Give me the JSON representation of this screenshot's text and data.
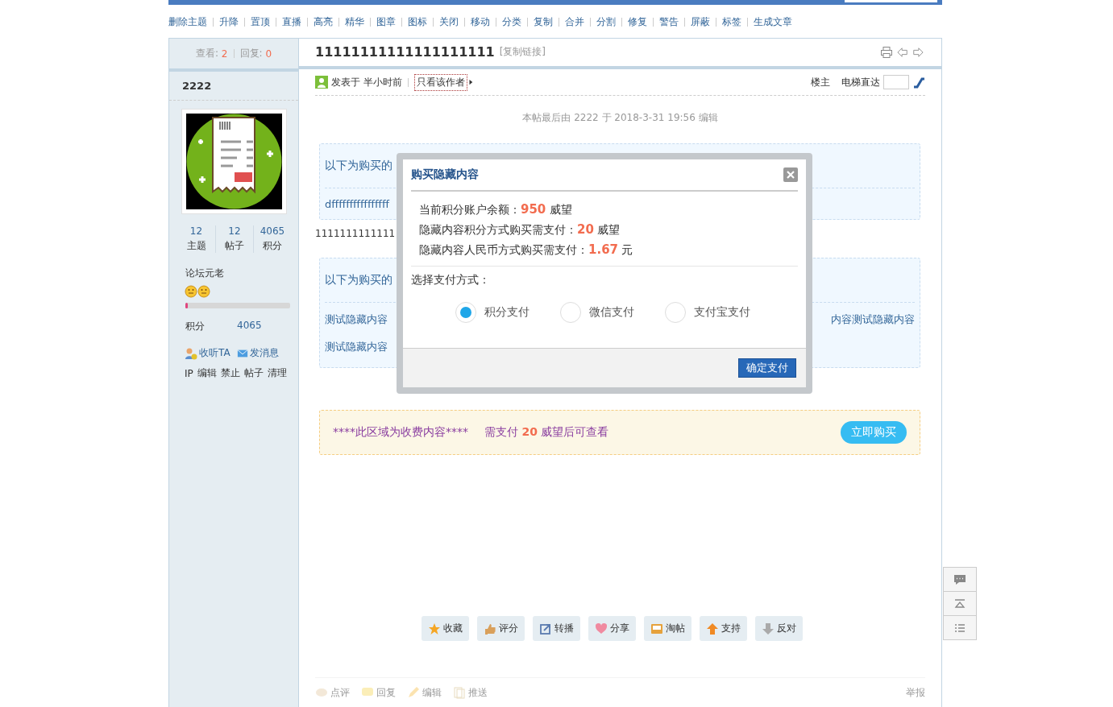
{
  "mod_actions": [
    "删除主题",
    "升降",
    "置顶",
    "直播",
    "高亮",
    "精华",
    "图章",
    "图标",
    "关闭",
    "移动",
    "分类",
    "复制",
    "合并",
    "分割",
    "修复",
    "警告",
    "屏蔽",
    "标签",
    "生成文章"
  ],
  "thread": {
    "views_label": "查看:",
    "views": "2",
    "replies_label": "回复:",
    "replies": "0",
    "title": "11111111111111111111",
    "copy_link": "[复制链接]"
  },
  "author": {
    "name": "2222",
    "stats": [
      {
        "value": "12",
        "label": "主题"
      },
      {
        "value": "12",
        "label": "帖子"
      },
      {
        "value": "4065",
        "label": "积分"
      }
    ],
    "rank": "论坛元老",
    "level": 0.02,
    "credits_label": "积分",
    "credits": "4065",
    "follow": "收听TA",
    "message": "发消息",
    "admin_links": [
      "IP",
      "编辑",
      "禁止",
      "帖子",
      "清理"
    ]
  },
  "post": {
    "posted": "发表于 半小时前",
    "only_author": "只看该作者",
    "floor": "楼主",
    "jump_label": "电梯直达",
    "edit_note": "本帖最后由 2222 于 2018-3-31 19:56 编辑"
  },
  "hidden_boxes": [
    {
      "heading": "以下为购买的",
      "lines": [
        {
          "left": "dffffffffffffffff"
        }
      ]
    },
    {
      "heading": "以下为购买的",
      "lines": [
        {
          "left": "测试隐藏内容",
          "right": "内容测试隐藏内容"
        },
        {
          "left": "测试隐藏内容"
        }
      ]
    }
  ],
  "plain_line": "1111111111111",
  "paid_notice": {
    "prefix": "****此区域为收费内容****",
    "text_before": "需支付",
    "amount": "20",
    "text_after": "威望后可查看",
    "button": "立即购买"
  },
  "post_actions": [
    {
      "kind": "star",
      "label": "收藏"
    },
    {
      "kind": "thumb",
      "label": "评分"
    },
    {
      "kind": "share",
      "label": "转播"
    },
    {
      "kind": "heart",
      "label": "分享"
    },
    {
      "kind": "tray",
      "label": "淘帖"
    },
    {
      "kind": "up",
      "label": "支持"
    },
    {
      "kind": "down",
      "label": "反对"
    }
  ],
  "footer_actions": [
    {
      "kind": "comment",
      "label": "点评"
    },
    {
      "kind": "reply",
      "label": "回复"
    },
    {
      "kind": "edit",
      "label": "编辑"
    },
    {
      "kind": "push",
      "label": "推送"
    }
  ],
  "report": "举报",
  "modal": {
    "title": "购买隐藏内容",
    "lines": [
      {
        "label": "当前积分账户余额：",
        "value": "950",
        "unit": "威望"
      },
      {
        "label": "隐藏内容积分方式购买需支付：",
        "value": "20",
        "unit": "威望"
      },
      {
        "label": "隐藏内容人民币方式购买需支付：",
        "value": "1.67",
        "unit": "元"
      }
    ],
    "choose_label": "选择支付方式：",
    "options": [
      {
        "label": "积分支付",
        "selected": true
      },
      {
        "label": "微信支付",
        "selected": false
      },
      {
        "label": "支付宝支付",
        "selected": false
      }
    ],
    "confirm": "确定支付"
  }
}
